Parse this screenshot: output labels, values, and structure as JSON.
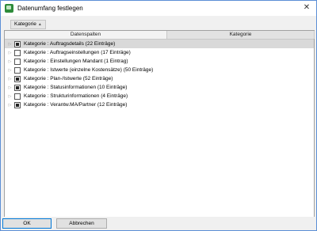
{
  "window": {
    "title": "Datenumfang festlegen",
    "close_glyph": "✕"
  },
  "groupbar": {
    "chip_label": "Kategorie",
    "sort_glyph": "▲"
  },
  "grid": {
    "columns": [
      "Datenspalten",
      "Kategorie"
    ],
    "rows": [
      {
        "label": "Kategorie : Auftragsdetails (22 Einträge)",
        "state": "partial",
        "selected": true
      },
      {
        "label": "Kategorie : Auftragseinstellungen (17 Einträge)",
        "state": "unchecked",
        "selected": false
      },
      {
        "label": "Kategorie : Einstellungen Mandant (1 Eintrag)",
        "state": "unchecked",
        "selected": false
      },
      {
        "label": "Kategorie : Istwerte (einzelne Kostensätze) (50 Einträge)",
        "state": "unchecked",
        "selected": false
      },
      {
        "label": "Kategorie : Plan-/Istwerte (52 Einträge)",
        "state": "partial",
        "selected": false
      },
      {
        "label": "Kategorie : Statusinformationen (10 Einträge)",
        "state": "partial",
        "selected": false
      },
      {
        "label": "Kategorie : Strukturinformationen (4 Einträge)",
        "state": "unchecked",
        "selected": false
      },
      {
        "label": "Kategorie : Verantw.MA/Partner (12 Einträge)",
        "state": "partial",
        "selected": false
      }
    ],
    "expander_glyph": "▷"
  },
  "buttons": {
    "ok": "OK",
    "cancel": "Abbrechen"
  },
  "colors": {
    "accent": "#0078d7",
    "app_icon": "#2d8b3a",
    "selected_row": "#d9d9d9"
  }
}
